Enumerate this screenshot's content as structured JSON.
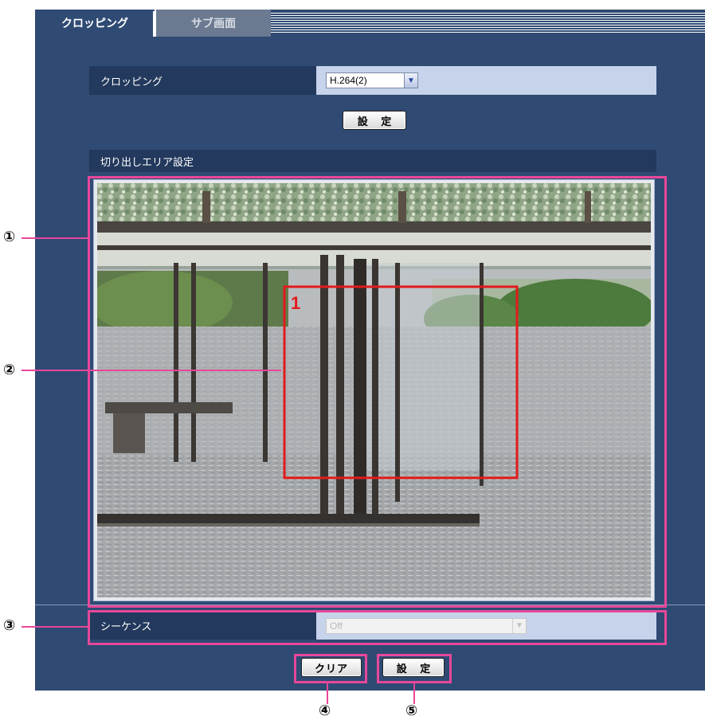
{
  "tabs": [
    {
      "label": "クロッピング",
      "active": true
    },
    {
      "label": "サブ画面",
      "active": false
    }
  ],
  "cropping": {
    "label": "クロッピング",
    "value": "H.264(2)"
  },
  "set_button": "設 定",
  "area_title": "切り出しエリア設定",
  "area_number": "1",
  "sequence": {
    "label": "シーケンス",
    "value": "Off"
  },
  "clear_button": "クリア",
  "set_button_bottom": "設 定",
  "callouts": [
    "①",
    "②",
    "③",
    "④",
    "⑤"
  ],
  "colors": {
    "panel": "#2f4a73",
    "row_label": "#23395d",
    "row_value": "#c6d3ea",
    "callout": "#e8479a",
    "crop_box": "#e21b1b"
  }
}
